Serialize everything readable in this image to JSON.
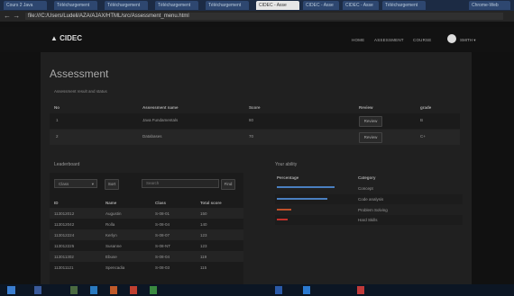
{
  "browser": {
    "tabs": [
      "Cours 2 Java",
      "Téléchargement",
      "Téléchargement",
      "Téléchargement",
      "Téléchargement",
      "CIDEC - Asse",
      "CIDEC - Asse",
      "CIDEC - Asse",
      "Téléchargement",
      "Chrome-Web"
    ],
    "url": "file:///C:/Users/Ludeli/AZA/AJAX/HTML/src/Assessment_menu.html"
  },
  "navbar": {
    "brand": "CIDEC",
    "menu": [
      "HOME",
      "ASSESSMENT",
      "COURSE"
    ],
    "user": "SMITH"
  },
  "page": {
    "title": "Assessment",
    "subtitle": "Assessment result and status"
  },
  "assessment_table": {
    "headers": [
      "No",
      "Assessment name",
      "Score",
      "Review",
      "grade"
    ],
    "rows": [
      {
        "no": "1",
        "name": "Java Fundamentals",
        "score": "80",
        "review": "Review",
        "grade": "B"
      },
      {
        "no": "2",
        "name": "Databases",
        "score": "70",
        "review": "Review",
        "grade": "C+"
      }
    ]
  },
  "leaderboard": {
    "title": "Leaderboard",
    "filter_value": "Class",
    "filter_button": "Sort",
    "search_placeholder": "Search",
    "search_button": "Find",
    "headers": [
      "ID",
      "Name",
      "Class",
      "Total score"
    ],
    "rows": [
      {
        "id": "113012012",
        "name": "Augustin",
        "class": "S-08-01",
        "score": "150"
      },
      {
        "id": "113012042",
        "name": "Rolla",
        "class": "S-08-04",
        "score": "140"
      },
      {
        "id": "113012224",
        "name": "Kerlyn",
        "class": "S-08-07",
        "score": "123"
      },
      {
        "id": "113012225",
        "name": "Susanne",
        "class": "S-08-NT",
        "score": "123"
      },
      {
        "id": "113011302",
        "name": "Ebuse",
        "class": "S-08-04",
        "score": "119"
      },
      {
        "id": "113011121",
        "name": "Spencadia",
        "class": "S-08-03",
        "score": "115"
      }
    ]
  },
  "ability": {
    "title": "Your ability",
    "headers": [
      "Percentage",
      "Category"
    ],
    "items": [
      {
        "category": "Concept",
        "percent": 0.8,
        "color": "#4a7fc0"
      },
      {
        "category": "Code analysis",
        "percent": 0.7,
        "color": "#4a7fc0"
      },
      {
        "category": "Problem Solving",
        "percent": 0.2,
        "color": "#c0502a"
      },
      {
        "category": "Hard Skills",
        "percent": 0.15,
        "color": "#c0302a"
      }
    ]
  }
}
